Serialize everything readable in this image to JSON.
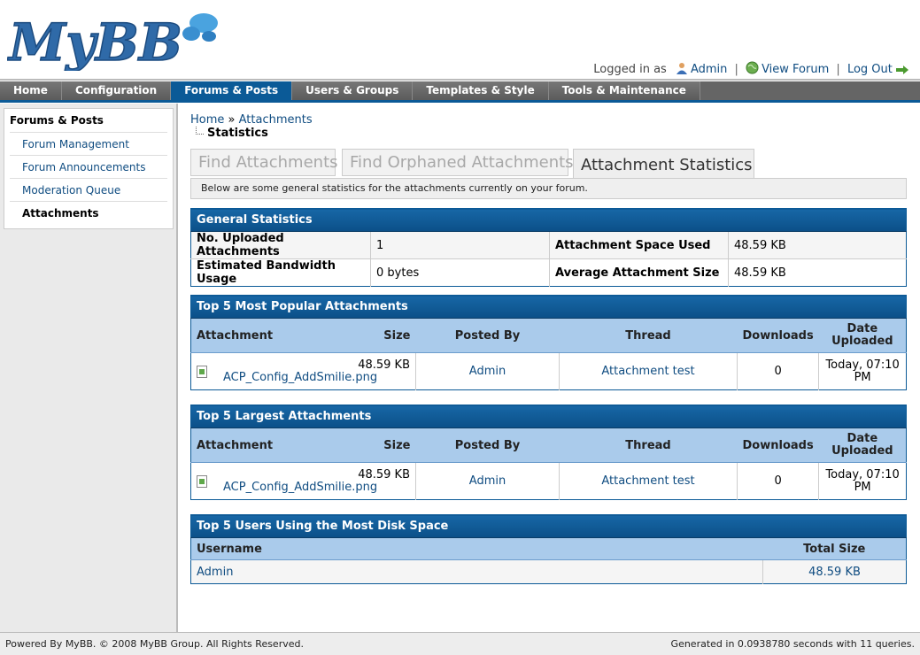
{
  "header": {
    "logo_text": "MyBB",
    "logged_in_as": "Logged in as",
    "user": "Admin",
    "view_forum": "View Forum",
    "log_out": "Log Out",
    "separator": "|"
  },
  "menu": [
    "Home",
    "Configuration",
    "Forums & Posts",
    "Users & Groups",
    "Templates & Style",
    "Tools & Maintenance"
  ],
  "sidebar": {
    "title": "Forums & Posts",
    "items": [
      "Forum Management",
      "Forum Announcements",
      "Moderation Queue",
      "Attachments"
    ]
  },
  "breadcrumb": {
    "home": "Home",
    "sep": "»",
    "section": "Attachments",
    "current": "Statistics"
  },
  "tabs": [
    "Find Attachments",
    "Find Orphaned Attachments",
    "Attachment Statistics"
  ],
  "tab_description": "Below are some general statistics for the attachments currently on your forum.",
  "general": {
    "title": "General Statistics",
    "uploaded_label": "No. Uploaded Attachments",
    "uploaded_value": "1",
    "space_label": "Attachment Space Used",
    "space_value": "48.59 KB",
    "bandwidth_label": "Estimated Bandwidth Usage",
    "bandwidth_value": "0 bytes",
    "avg_label": "Average Attachment Size",
    "avg_value": "48.59 KB"
  },
  "columns": {
    "attachment": "Attachment",
    "size": "Size",
    "posted_by": "Posted By",
    "thread": "Thread",
    "downloads": "Downloads",
    "date_uploaded": "Date Uploaded"
  },
  "popular": {
    "title": "Top 5 Most Popular Attachments",
    "row": {
      "file": "ACP_Config_AddSmilie.png",
      "size": "48.59 KB",
      "posted_by": "Admin",
      "thread": "Attachment test",
      "downloads": "0",
      "date": "Today, 07:10 PM"
    }
  },
  "largest": {
    "title": "Top 5 Largest Attachments",
    "row": {
      "file": "ACP_Config_AddSmilie.png",
      "size": "48.59 KB",
      "posted_by": "Admin",
      "thread": "Attachment test",
      "downloads": "0",
      "date": "Today, 07:10 PM"
    }
  },
  "users": {
    "title": "Top 5 Users Using the Most Disk Space",
    "col_username": "Username",
    "col_total": "Total Size",
    "row": {
      "username": "Admin",
      "total": "48.59 KB"
    }
  },
  "footer": {
    "left": "Powered By MyBB. © 2008 MyBB Group. All Rights Reserved.",
    "right": "Generated in 0.0938780 seconds with 11 queries."
  }
}
